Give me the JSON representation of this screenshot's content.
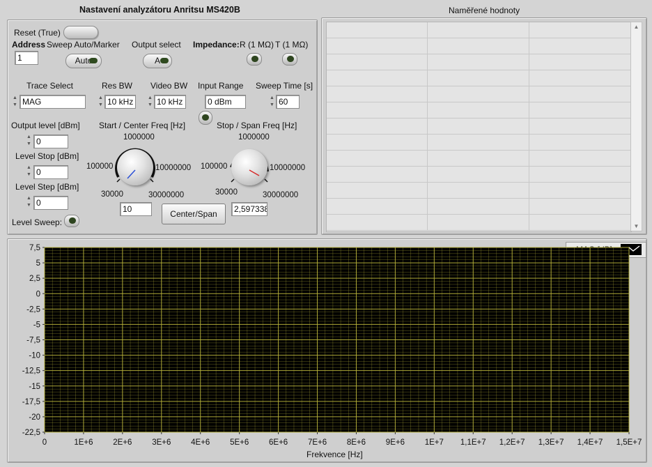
{
  "settings_panel": {
    "title": "Nastavení analyzátoru Anritsu MS420B",
    "reset_label": "Reset (True)",
    "address_label": "Address",
    "address_value": "1",
    "sweep_label": "Sweep Auto/Marker",
    "sweep_button": "Auto",
    "output_select_label": "Output select",
    "output_select_button": "A",
    "impedance_label": "Impedance:",
    "impedance_r_label": "R (1 MΩ)",
    "impedance_t_label": "T (1 MΩ)",
    "trace_select_label": "Trace Select",
    "trace_select_value": "MAG",
    "res_bw_label": "Res BW",
    "res_bw_value": "10 kHz",
    "video_bw_label": "Video BW",
    "video_bw_value": "10 kHz",
    "input_range_label": "Input Range",
    "input_range_value": "0 dBm",
    "sweep_time_label": "Sweep Time [s]",
    "sweep_time_value": "60",
    "output_level_label": "Output level [dBm]",
    "output_level_value": "0",
    "level_stop_label": "Level Stop [dBm]",
    "level_stop_value": "0",
    "level_step_label": "Level Step [dBm]",
    "level_step_value": "0",
    "level_sweep_label": "Level Sweep:",
    "start_freq_label": "Start / Center Freq [Hz]",
    "stop_freq_label": "Stop / Span Freq [Hz]",
    "knob_top": "1000000",
    "knob_left": "100000",
    "knob_right": "10000000",
    "knob_bottom_left": "30000",
    "knob_bottom_right": "30000000",
    "start_freq_value": "10",
    "stop_freq_value": "2,597338",
    "center_span_button": "Center/Span"
  },
  "measured_panel": {
    "title": "Naměřené hodnoty"
  },
  "graph": {
    "legend_label": "MAG [dB]",
    "x_axis_label": "Frekvence [Hz]",
    "background_color": "#000000",
    "grid_color": "#b7b23a"
  },
  "chart_data": {
    "type": "line",
    "series": [
      {
        "name": "MAG [dB]",
        "values": []
      }
    ],
    "xlabel": "Frekvence [Hz]",
    "ylabel": "",
    "xlim": [
      0,
      15000000
    ],
    "ylim": [
      -22.5,
      7.5
    ],
    "x_ticks": [
      "0",
      "1E+6",
      "2E+6",
      "3E+6",
      "4E+6",
      "5E+6",
      "6E+6",
      "7E+6",
      "8E+6",
      "9E+6",
      "1E+7",
      "1,1E+7",
      "1,2E+7",
      "1,3E+7",
      "1,4E+7",
      "1,5E+7"
    ],
    "y_ticks": [
      "7,5",
      "5",
      "2,5",
      "0",
      "-2,5",
      "-5",
      "-7,5",
      "-10",
      "-12,5",
      "-15",
      "-17,5",
      "-20",
      "-22,5"
    ],
    "grid": true,
    "legend_position": "top-right"
  }
}
